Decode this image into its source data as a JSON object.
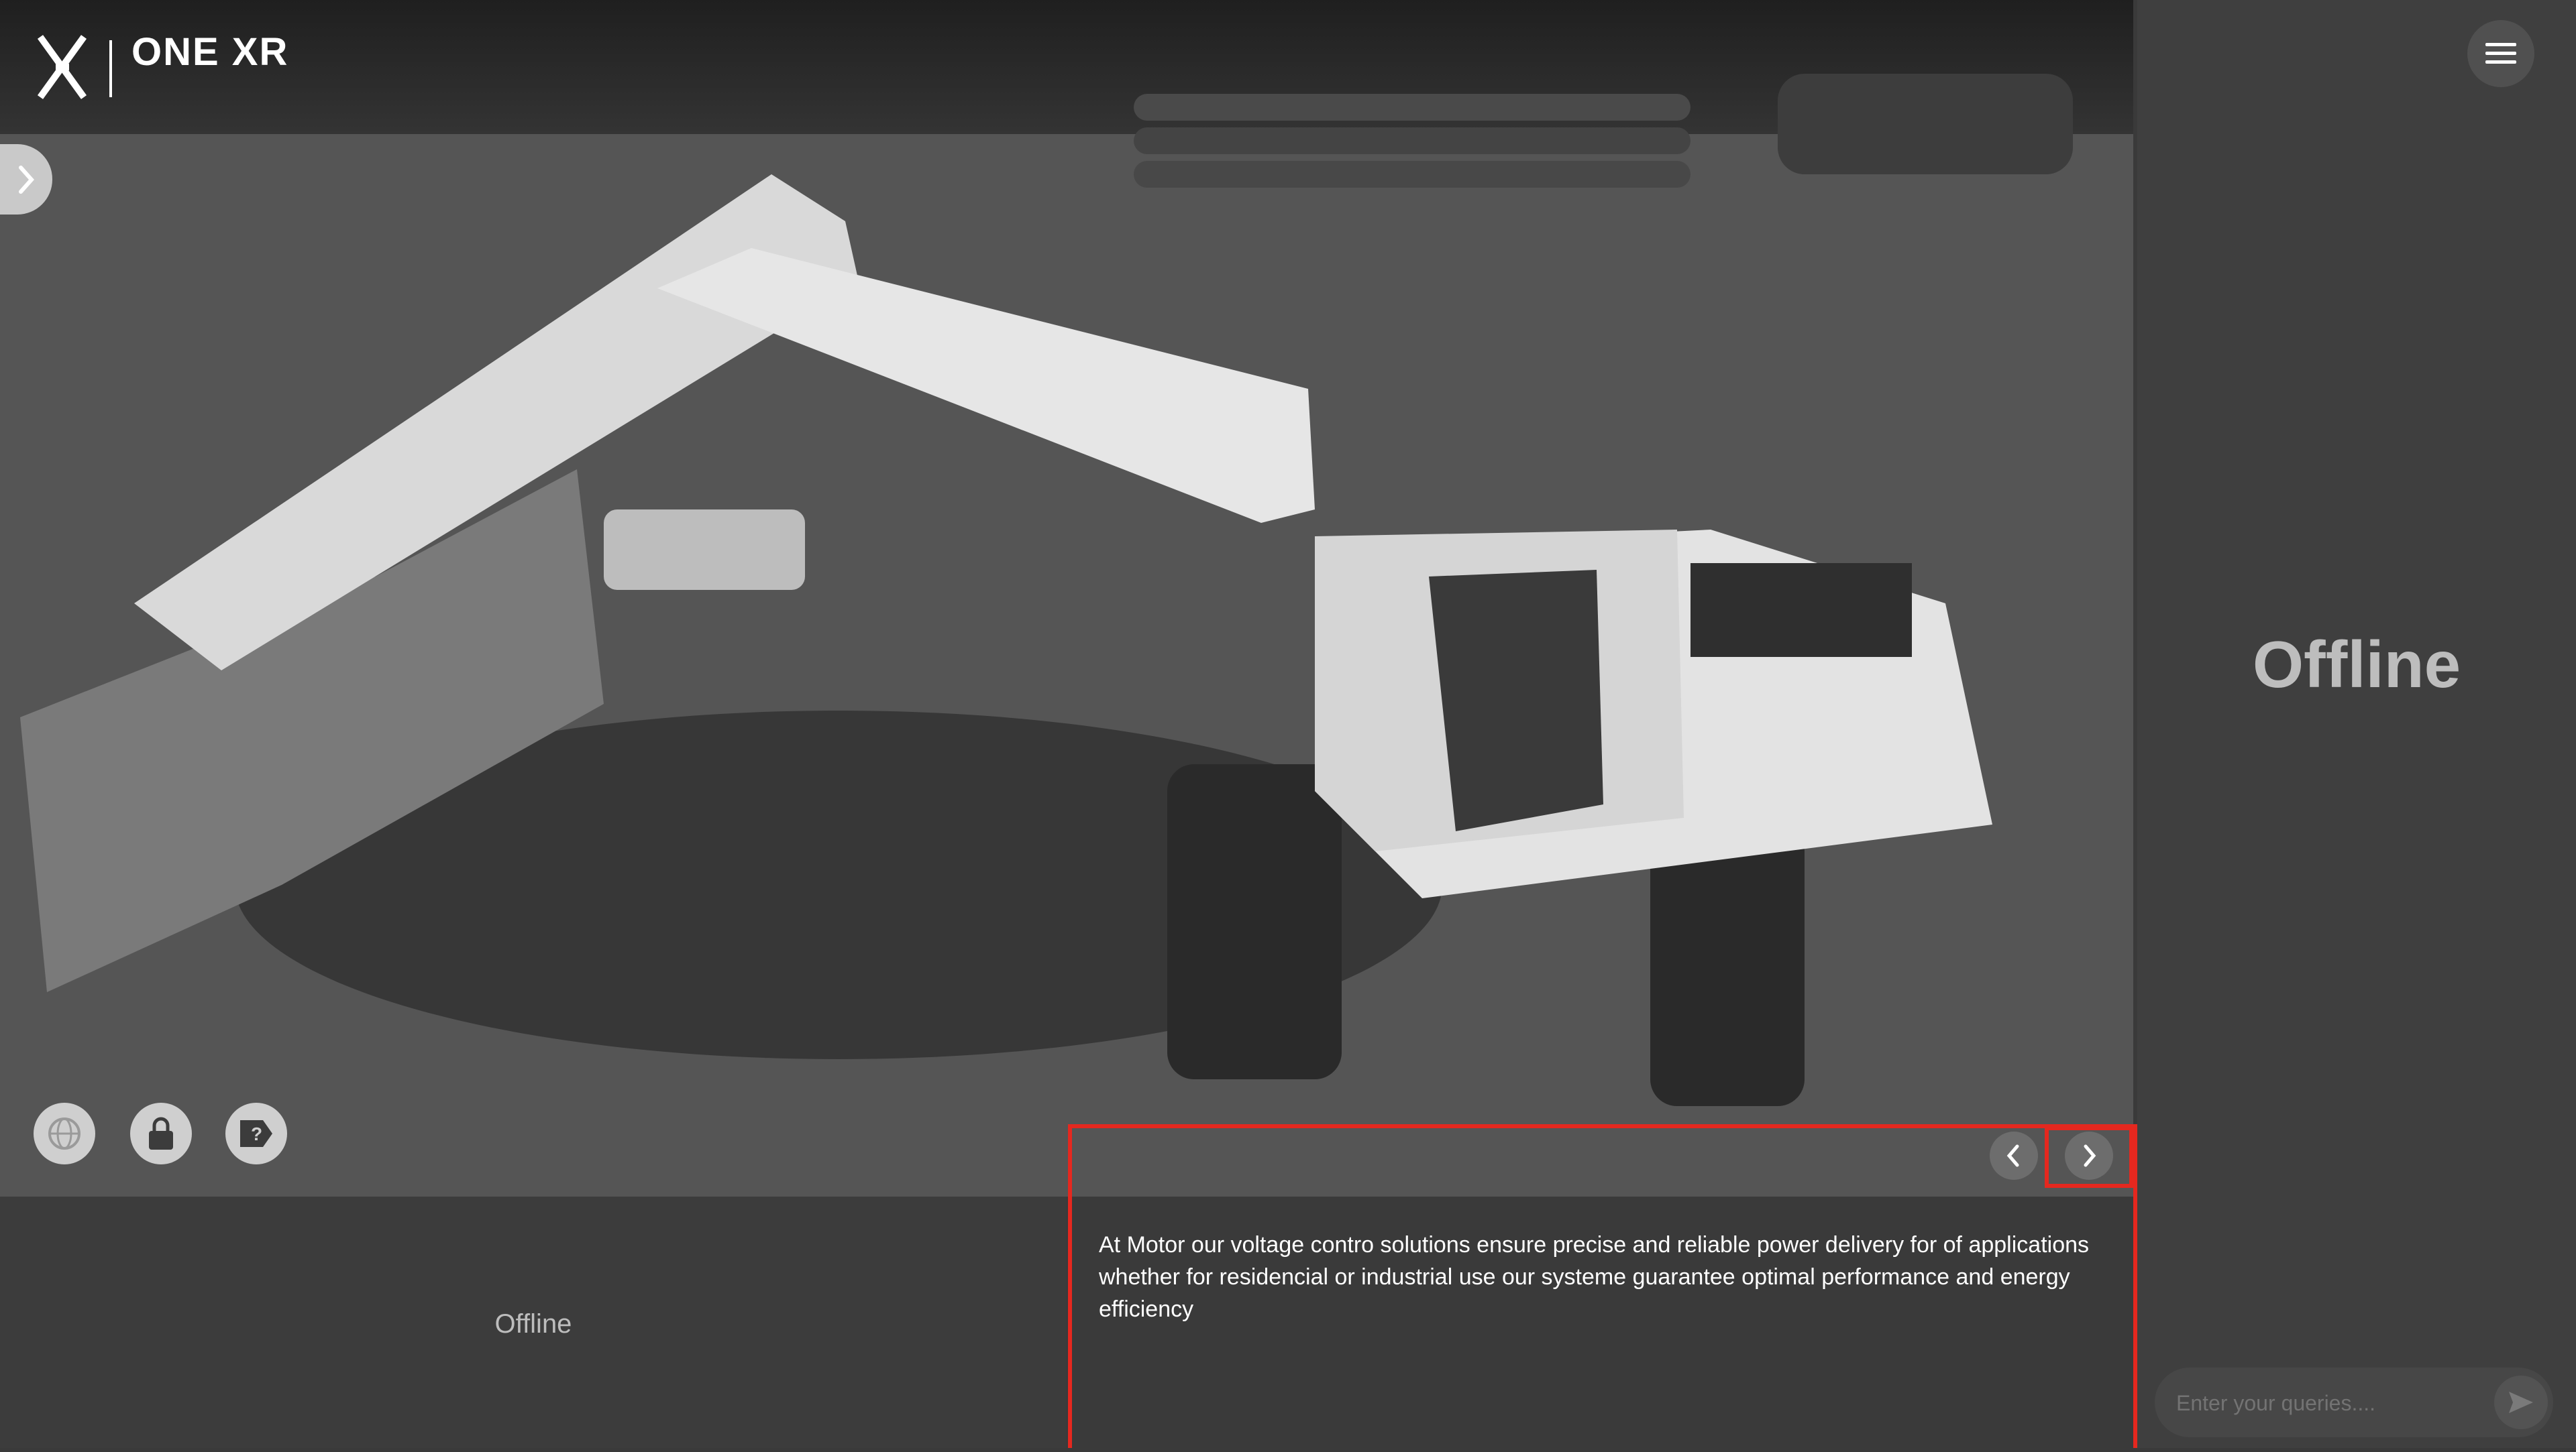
{
  "brand": {
    "name": "ONE XR"
  },
  "viewport": {
    "description_text": "At Motor our voltage contro solutions ensure precise and reliable power delivery for of applications whether for residencial or industrial use our systeme guarantee optimal performance and energy efficiency"
  },
  "status": {
    "bottom": "Offline",
    "right": "Offline"
  },
  "chat": {
    "placeholder": "Enter your queries....",
    "value": ""
  },
  "icons": {
    "side_toggle": "chevron-right-icon",
    "tool_1": "globe-icon",
    "tool_2": "lock-icon",
    "tool_3": "help-tag-icon",
    "prev": "chevron-left-icon",
    "next": "chevron-right-icon",
    "menu": "hamburger-menu-icon",
    "send": "send-icon"
  },
  "colors": {
    "highlight": "#e5281f",
    "panel_bg": "#3f3f3f"
  }
}
